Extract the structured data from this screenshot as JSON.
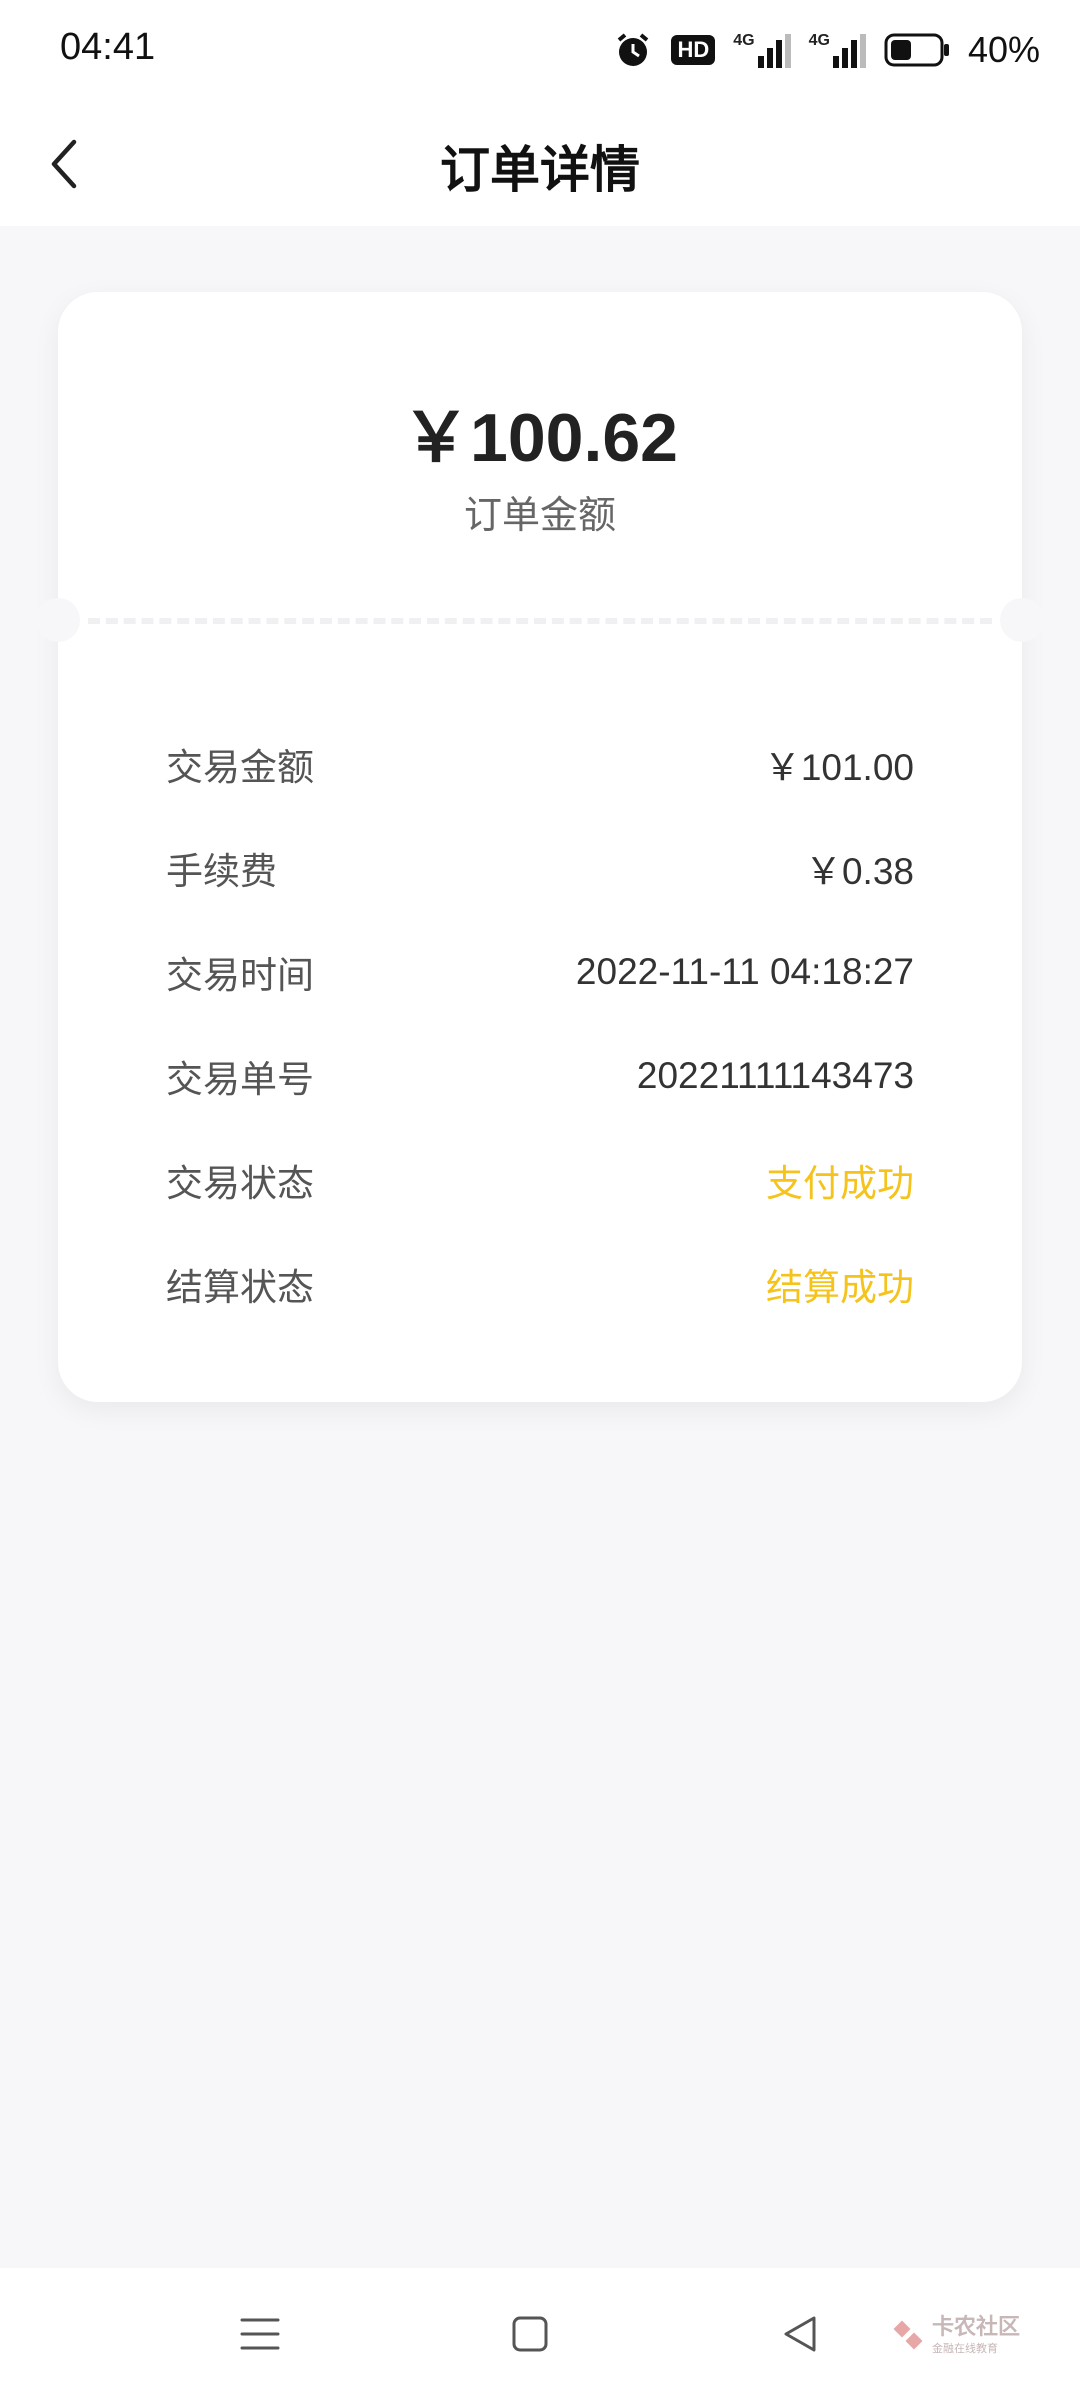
{
  "status_bar": {
    "time": "04:41",
    "battery": "40%",
    "network_1": "4G",
    "network_2": "4G",
    "hd_badge": "HD"
  },
  "header": {
    "title": "订单详情"
  },
  "order": {
    "amount": "￥100.62",
    "amount_label": "订单金额",
    "details": [
      {
        "label": "交易金额",
        "value": "￥101.00"
      },
      {
        "label": "手续费",
        "value": "￥0.38"
      },
      {
        "label": "交易时间",
        "value": "2022-11-11 04:18:27"
      },
      {
        "label": "交易单号",
        "value": "20221111143473"
      },
      {
        "label": "交易状态",
        "value": "支付成功"
      },
      {
        "label": "结算状态",
        "value": "结算成功"
      }
    ]
  },
  "watermark": {
    "title": "卡农社区",
    "subtitle": "金融在线教育"
  },
  "colors": {
    "accent": "#f5c31b",
    "background": "#f7f7f9"
  }
}
